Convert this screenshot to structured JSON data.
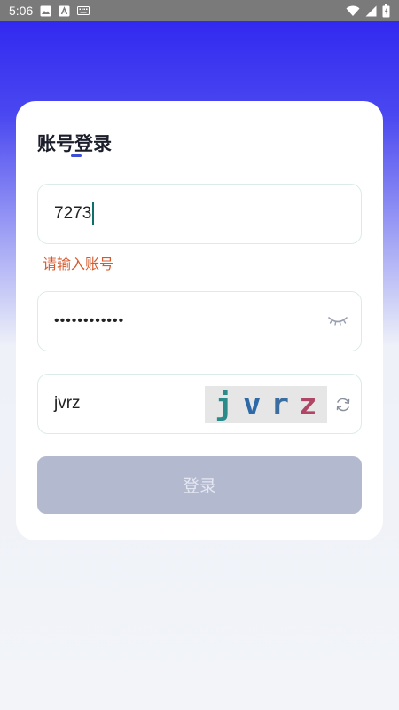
{
  "status_bar": {
    "time": "5:06"
  },
  "login": {
    "title": "账号登录",
    "account_value": "7273",
    "account_error": "请输入账号",
    "password_masked": "••••••••••••",
    "captcha_value": "jvrz",
    "captcha_chars": [
      "j",
      "v",
      "r",
      "z"
    ],
    "button_label": "登录"
  },
  "colors": {
    "accent": "#3b4ed6",
    "error": "#d65a2c",
    "button_disabled": "#b3b9cf",
    "captcha_j": "#2b8a8a",
    "captcha_v": "#2e6aa8",
    "captcha_r": "#3a6ea0",
    "captcha_z": "#b04666"
  }
}
